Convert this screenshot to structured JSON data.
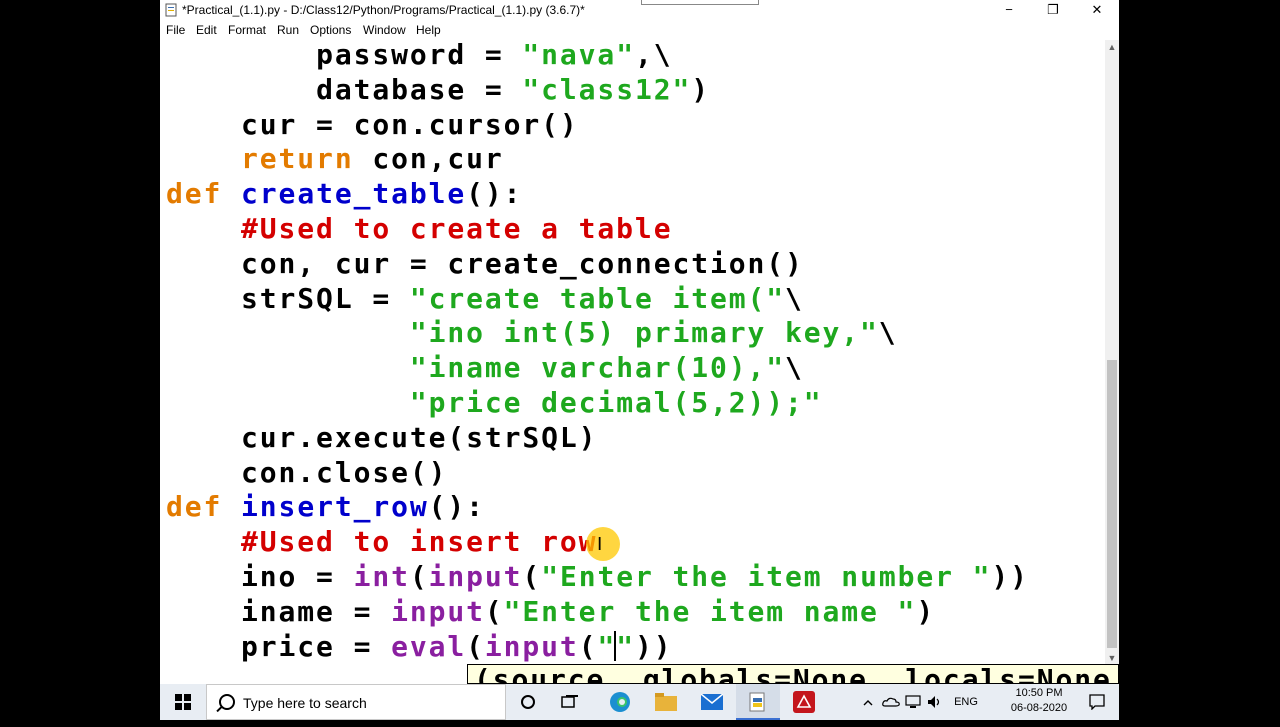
{
  "window": {
    "title": "*Practical_(1.1).py - D:/Class12/Python/Programs/Practical_(1.1).py (3.6.7)*",
    "minimize": "−",
    "maximize": "❐",
    "close": "✕"
  },
  "menu": {
    "items": [
      "File",
      "Edit",
      "Format",
      "Run",
      "Options",
      "Window",
      "Help"
    ]
  },
  "code": {
    "line1": {
      "indent": "        ",
      "a": "password = ",
      "s": "\"nava\"",
      "b": ",\\"
    },
    "line2": {
      "indent": "        ",
      "a": "database = ",
      "s": "\"class12\"",
      "b": ")"
    },
    "line3": {
      "indent": "    ",
      "a": "cur = con.cursor()"
    },
    "line4": {
      "indent": "    ",
      "k": "return",
      "a": " con,cur"
    },
    "line5": {
      "k": "def",
      "sp": " ",
      "f": "create_table",
      "a": "():"
    },
    "line6": {
      "indent": "    ",
      "c": "#Used to create a table"
    },
    "line7": {
      "indent": "    ",
      "a": "con, cur = create_connection()"
    },
    "line8": {
      "indent": "    ",
      "a": "strSQL = ",
      "s": "\"create table item(\"",
      "b": "\\"
    },
    "line9": {
      "indent": "             ",
      "s": "\"ino int(5) primary key,\"",
      "b": "\\"
    },
    "line10": {
      "indent": "             ",
      "s": "\"iname varchar(10),\"",
      "b": "\\"
    },
    "line11": {
      "indent": "             ",
      "s": "\"price decimal(5,2));\""
    },
    "line12": {
      "indent": "    ",
      "a": "cur.execute(strSQL)"
    },
    "line13": {
      "indent": "    ",
      "a": "con.close()"
    },
    "line14": {
      "k": "def",
      "sp": " ",
      "f": "insert_row",
      "a": "():"
    },
    "line15": {
      "indent": "    ",
      "c": "#Used to insert row"
    },
    "line16": {
      "indent": "    ",
      "a": "ino = ",
      "bi1": "int",
      "p1": "(",
      "bi2": "input",
      "p2": "(",
      "s": "\"Enter the item number \"",
      "b": "))"
    },
    "line17": {
      "indent": "    ",
      "a": "iname = ",
      "bi1": "input",
      "p1": "(",
      "s": "\"Enter the item name \"",
      "b": ")"
    },
    "line18": {
      "indent": "    ",
      "a": "price = ",
      "bi1": "eval",
      "p1": "(",
      "bi2": "input",
      "p2": "(",
      "s": "\"\"",
      "b": "))"
    }
  },
  "calltip": "(source, globals=None, locals=None",
  "taskbar": {
    "search_placeholder": "Type here to search",
    "language": "ENG",
    "time": "10:50 PM",
    "date": "06-08-2020"
  }
}
